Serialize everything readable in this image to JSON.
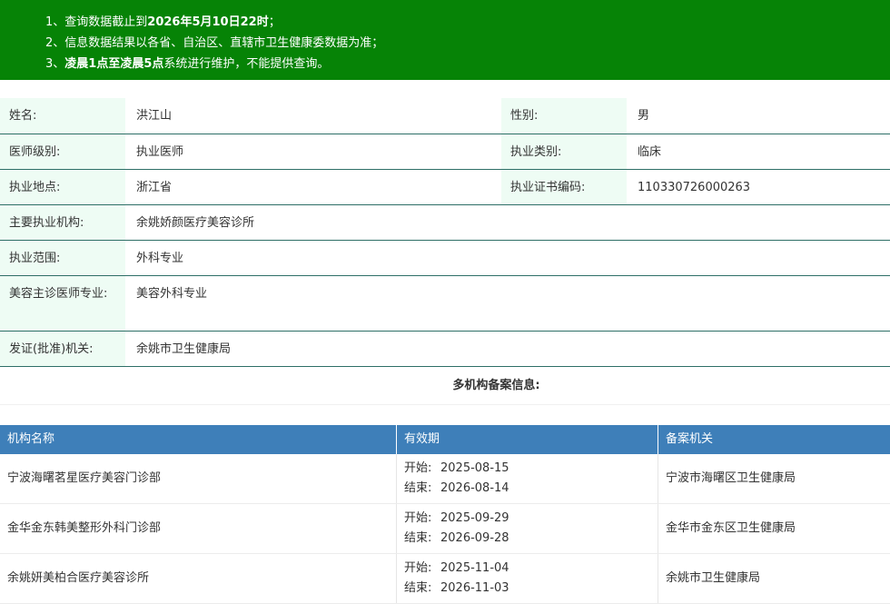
{
  "notice": {
    "line1": {
      "pre": "1、查询数据截止到",
      "bold": "2026年5月10日22时",
      "post": "；"
    },
    "line2": "2、信息数据结果以各省、自治区、直辖市卫生健康委数据为准；",
    "line3": {
      "pre": "3、",
      "bold": "凌晨1点至凌晨5点",
      "post": "系统进行维护，不能提供查询。"
    }
  },
  "profile": {
    "name_label": "姓名:",
    "name": "洪江山",
    "gender_label": "性别:",
    "gender": "男",
    "level_label": "医师级别:",
    "level": "执业医师",
    "category_label": "执业类别:",
    "category": "临床",
    "location_label": "执业地点:",
    "location": "浙江省",
    "cert_label": "执业证书编码:",
    "cert": "110330726000263",
    "institution_label": "主要执业机构:",
    "institution": "余姚娇颜医疗美容诊所",
    "scope_label": "执业范围:",
    "scope": "外科专业",
    "cosmetic_label": "美容主诊医师专业:",
    "cosmetic": "美容外科专业",
    "authority_label": "发证(批准)机关:",
    "authority": "余姚市卫生健康局"
  },
  "multi_title": "多机构备案信息:",
  "table": {
    "headers": [
      "机构名称",
      "有效期",
      "备案机关"
    ],
    "start_label": "开始:",
    "end_label": "结束:",
    "rows": [
      {
        "org": "宁波海曙茗星医疗美容门诊部",
        "start": "2025-08-15",
        "end": "2026-08-14",
        "authority": "宁波市海曙区卫生健康局"
      },
      {
        "org": "金华金东韩美整形外科门诊部",
        "start": "2025-09-29",
        "end": "2026-09-28",
        "authority": "金华市金东区卫生健康局"
      },
      {
        "org": "余姚妍美柏合医疗美容诊所",
        "start": "2025-11-04",
        "end": "2026-11-03",
        "authority": "余姚市卫生健康局"
      }
    ]
  }
}
